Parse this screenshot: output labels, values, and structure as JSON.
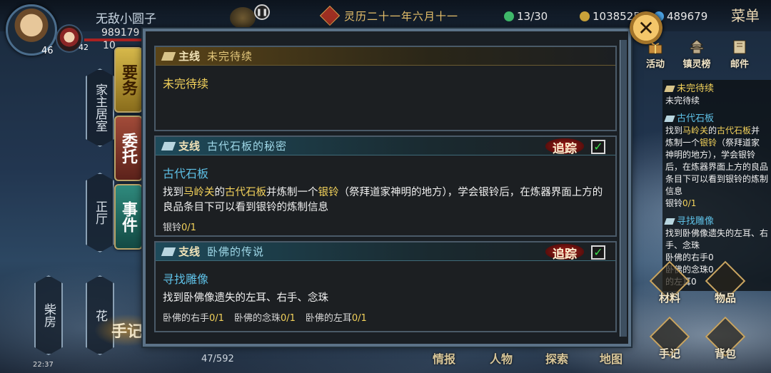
{
  "player": {
    "name": "无敌小圆子",
    "level": "46",
    "stat_a": "989179",
    "stat_b": "10",
    "companion_level": "42"
  },
  "calendar": {
    "date": "灵历二十一年六月十一"
  },
  "resources": [
    {
      "icon": "jade-icon",
      "value": "13/30",
      "color": "#3fb86a"
    },
    {
      "icon": "coin-icon",
      "value": "1038525",
      "color": "#c9a23a"
    },
    {
      "icon": "gem-icon",
      "value": "489679",
      "color": "#4aa0e0"
    }
  ],
  "menu_label": "菜单",
  "right_buttons": {
    "activity": "活动",
    "town": "镇灵榜",
    "mail": "邮件"
  },
  "left_nav": {
    "home_room": "家主居室",
    "hall": "正厅",
    "woodshed": "柴房",
    "garden": "花"
  },
  "tabs": {
    "duties": "要务",
    "commissions": "委托",
    "events": "事件"
  },
  "notebook_label": "手记",
  "stamina": "47/592",
  "clock": "22:37",
  "quests": {
    "main": {
      "tag": "主线",
      "name": "未完待续",
      "title": "未完待续"
    },
    "side1": {
      "tag": "支线",
      "name": "古代石板的秘密",
      "track_label": "追踪",
      "title": "古代石板",
      "desc_parts": [
        "找到",
        "马岭关",
        "的",
        "古代石板",
        "并炼制一个",
        "银铃",
        "（祭拜道家神明的地方），学会银铃后，在炼器界面上方的良品条目下可以看到银铃的炼制信息"
      ],
      "progress": [
        {
          "label": "银铃",
          "value": "0/1"
        }
      ]
    },
    "side2": {
      "tag": "支线",
      "name": "卧佛的传说",
      "track_label": "追踪",
      "title": "寻找雕像",
      "desc": "找到卧佛像遗失的左耳、右手、念珠",
      "progress": [
        {
          "label": "卧佛的右手",
          "value": "0/1"
        },
        {
          "label": "卧佛的念珠",
          "value": "0/1"
        },
        {
          "label": "卧佛的左耳",
          "value": "0/1"
        }
      ]
    }
  },
  "tracker": {
    "main_title": "未完待续",
    "main_desc": "未完待续",
    "side1_title": "古代石板",
    "side1_desc_parts": [
      "找到",
      "马岭关",
      "的",
      "古代石板",
      "并炼制一个",
      "银铃",
      "（祭拜道家神明的地方），学会银铃后，在炼器界面上方的良品条目下可以看到银铃的炼制信息"
    ],
    "side1_prog_label": "银铃",
    "side1_prog_value": "0/1",
    "side2_title": "寻找雕像",
    "side2_desc": "找到卧佛像遗失的左耳、右手、念珠",
    "side2_frag_a": "卧佛的右手0",
    "side2_frag_b": "卧佛的念珠0",
    "side2_frag_c": "的左耳0"
  },
  "bottom_buttons": {
    "materials": "材料",
    "items": "物品",
    "notebook": "手记",
    "backpack": "背包"
  },
  "bottom_nav": [
    "情报",
    "人物",
    "探索",
    "地图"
  ]
}
